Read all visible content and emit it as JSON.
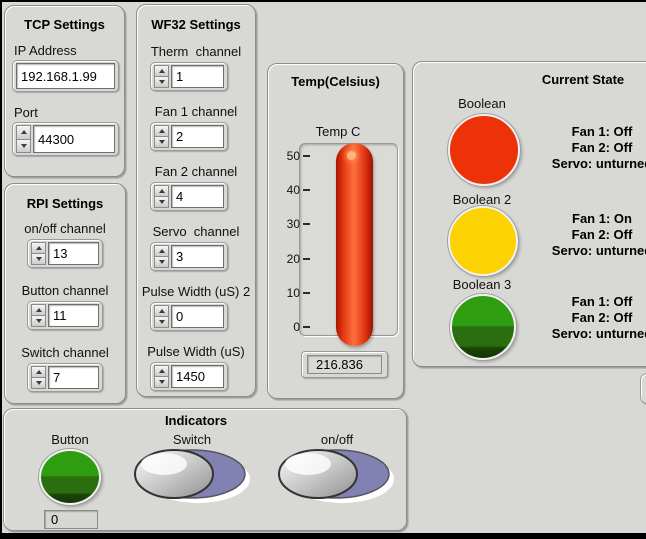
{
  "tcp": {
    "title": "TCP Settings",
    "ip_label": "IP Address",
    "ip_value": "192.168.1.99",
    "port_label": "Port",
    "port_value": "44300"
  },
  "rpi": {
    "title": "RPI Settings",
    "items": [
      {
        "label": "on/off channel",
        "value": "13"
      },
      {
        "label": "Button channel",
        "value": "11"
      },
      {
        "label": "Switch channel",
        "value": "7"
      }
    ]
  },
  "wf32": {
    "title": "WF32 Settings",
    "items": [
      {
        "label": "Therm  channel",
        "value": "1"
      },
      {
        "label": "Fan 1 channel",
        "value": "2"
      },
      {
        "label": "Fan 2 channel",
        "value": "4"
      },
      {
        "label": "Servo  channel",
        "value": "3"
      },
      {
        "label": "Pulse Width (uS) 2",
        "value": "0"
      },
      {
        "label": "Pulse Width (uS)",
        "value": "1450"
      }
    ]
  },
  "temp": {
    "title": "Temp(Celsius)",
    "gauge_label": "Temp C",
    "scale": [
      "50",
      "40",
      "30",
      "20",
      "10",
      "0"
    ],
    "value": "216.836",
    "tube_color": "#e03510"
  },
  "current_state": {
    "title": "Current State",
    "leds": [
      {
        "label": "Boolean",
        "color": "#ee3207"
      },
      {
        "label": "Boolean 2",
        "color": "#fdd203"
      },
      {
        "label": "Boolean 3",
        "color": "#2f9d10"
      }
    ],
    "status": [
      {
        "lines": [
          "Fan 1: Off",
          "Fan 2: Off",
          "Servo: unturned"
        ]
      },
      {
        "lines": [
          "Fan 1: On",
          "Fan 2: Off",
          "Servo: unturned"
        ]
      },
      {
        "lines": [
          "Fan 1: Off",
          "Fan 2: Off",
          "Servo: unturned"
        ]
      }
    ]
  },
  "indicators": {
    "title": "Indicators",
    "button_label": "Button",
    "button_value": "0",
    "switch_label": "Switch",
    "onoff_label": "on/off"
  }
}
